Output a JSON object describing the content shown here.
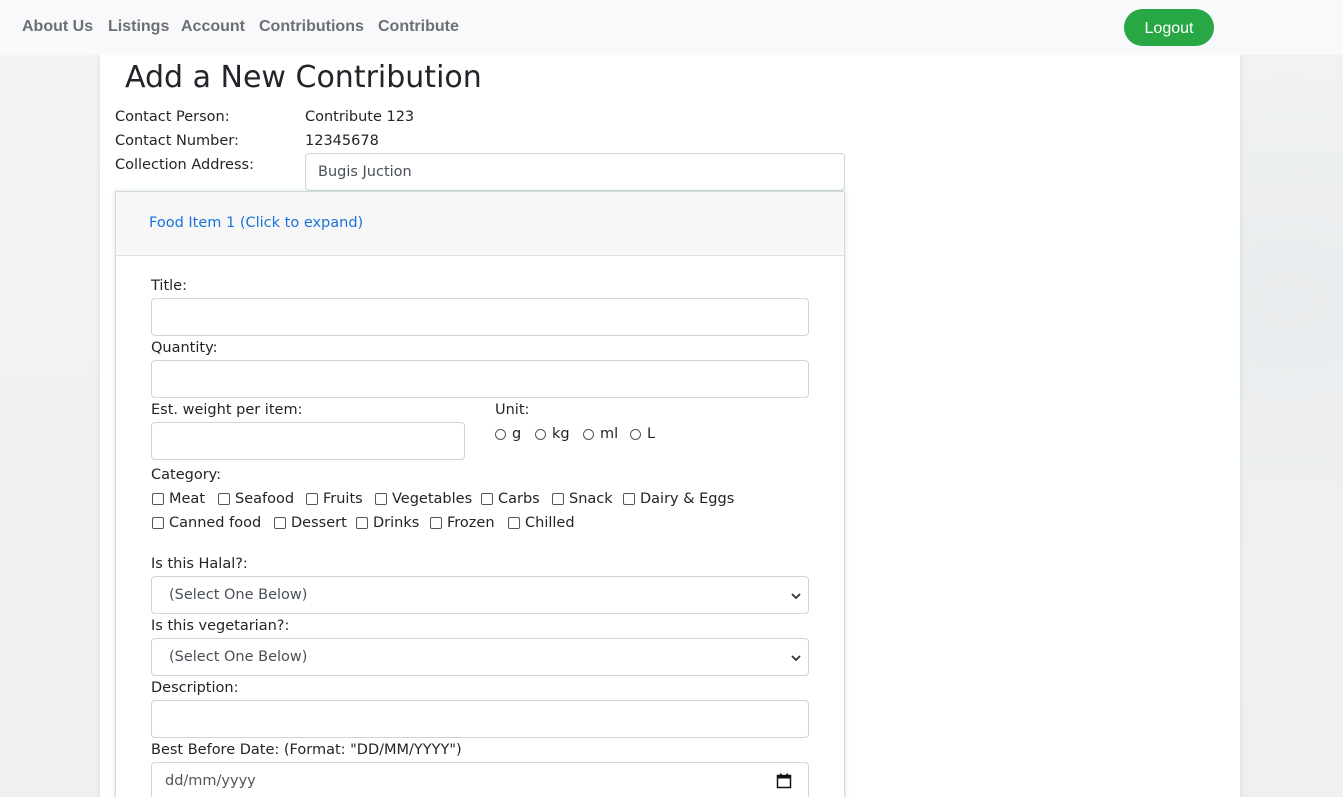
{
  "nav": {
    "links": [
      "About Us",
      "Listings",
      "Account",
      "Contributions",
      "Contribute"
    ],
    "logout": "Logout"
  },
  "page": {
    "title": "Add a New Contribution"
  },
  "contact": {
    "person_label": "Contact Person:",
    "person_value": "Contribute 123",
    "number_label": "Contact Number:",
    "number_value": "12345678",
    "address_label": "Collection Address:",
    "address_value": "Bugis Juction"
  },
  "food_item": {
    "header": "Food Item 1 (Click to expand)",
    "title_label": "Title:",
    "title_value": "",
    "quantity_label": "Quantity:",
    "quantity_value": "",
    "weight_label": "Est. weight per item:",
    "weight_value": "",
    "unit_label": "Unit:",
    "units": [
      "g",
      "kg",
      "ml",
      "L"
    ],
    "category_label": "Category:",
    "categories_row1": [
      "Meat",
      "Seafood",
      "Fruits",
      "Vegetables",
      "Carbs",
      "Snack",
      "Dairy & Eggs"
    ],
    "categories_row2": [
      "Canned food",
      "Dessert",
      "Drinks",
      "Frozen",
      "Chilled"
    ],
    "halal_label": "Is this Halal?:",
    "halal_selected": "(Select One Below)",
    "vegetarian_label": "Is this vegetarian?:",
    "vegetarian_selected": "(Select One Below)",
    "description_label": "Description:",
    "description_value": "",
    "best_before_label": "Best Before Date: (Format: \"DD/MM/YYYY\")",
    "best_before_placeholder": "dd/mm/yyyy"
  },
  "icons": {
    "select_arrow": "chevron-down-icon",
    "date_picker": "calendar-icon"
  },
  "colors": {
    "accent_green": "#28a745",
    "link_blue": "#1a73d9",
    "nav_text": "#6c6f73"
  }
}
